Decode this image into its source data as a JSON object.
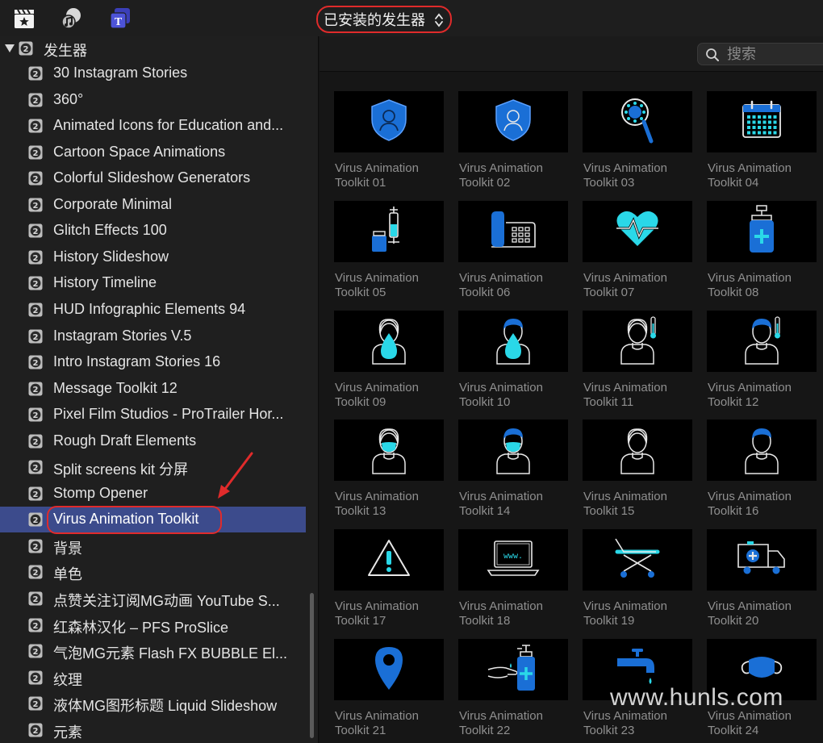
{
  "toolbar": {
    "icons": [
      "clapperboard-star-icon",
      "music-photo-icon",
      "titles-generators-icon"
    ],
    "source_select": "已安装的发生器"
  },
  "sidebar": {
    "root_label": "发生器",
    "items": [
      {
        "label": "30 Instagram Stories"
      },
      {
        "label": "360°"
      },
      {
        "label": "Animated Icons for Education and..."
      },
      {
        "label": "Cartoon Space Animations"
      },
      {
        "label": "Colorful Slideshow Generators"
      },
      {
        "label": "Corporate Minimal"
      },
      {
        "label": "Glitch Effects 100"
      },
      {
        "label": "History Slideshow"
      },
      {
        "label": "History Timeline"
      },
      {
        "label": "HUD Infographic Elements 94"
      },
      {
        "label": "Instagram Stories V.5"
      },
      {
        "label": "Intro Instagram Stories 16"
      },
      {
        "label": "Message Toolkit 12"
      },
      {
        "label": "Pixel Film Studios - ProTrailer Hor..."
      },
      {
        "label": "Rough Draft Elements"
      },
      {
        "label": "Split screens kit 分屏"
      },
      {
        "label": "Stomp Opener"
      },
      {
        "label": "Virus Animation Toolkit",
        "selected": true
      },
      {
        "label": "背景"
      },
      {
        "label": "单色"
      },
      {
        "label": "点赞关注订阅MG动画 YouTube S..."
      },
      {
        "label": "红森林汉化 – PFS ProSlice"
      },
      {
        "label": "气泡MG元素 Flash FX BUBBLE El..."
      },
      {
        "label": "纹理"
      },
      {
        "label": "液体MG图形标题 Liquid Slideshow"
      },
      {
        "label": "元素"
      }
    ]
  },
  "search": {
    "placeholder": "搜索",
    "value": ""
  },
  "browser": {
    "items": [
      {
        "line1": "Virus Animation",
        "line2": "Toolkit 01",
        "icon": "shield-person-icon"
      },
      {
        "line1": "Virus Animation",
        "line2": "Toolkit 02",
        "icon": "shield-person-outline-icon"
      },
      {
        "line1": "Virus Animation",
        "line2": "Toolkit 03",
        "icon": "magnifier-virus-icon"
      },
      {
        "line1": "Virus Animation",
        "line2": "Toolkit 04",
        "icon": "calendar-icon"
      },
      {
        "line1": "Virus Animation",
        "line2": "Toolkit 05",
        "icon": "syringe-vial-icon"
      },
      {
        "line1": "Virus Animation",
        "line2": "Toolkit 06",
        "icon": "desk-phone-icon"
      },
      {
        "line1": "Virus Animation",
        "line2": "Toolkit 07",
        "icon": "heart-pulse-icon"
      },
      {
        "line1": "Virus Animation",
        "line2": "Toolkit 08",
        "icon": "sanitizer-bottle-icon"
      },
      {
        "line1": "Virus Animation",
        "line2": "Toolkit 09",
        "icon": "person-drop-icon"
      },
      {
        "line1": "Virus Animation",
        "line2": "Toolkit 10",
        "icon": "person-drop-male-icon"
      },
      {
        "line1": "Virus Animation",
        "line2": "Toolkit 11",
        "icon": "person-thermometer-icon"
      },
      {
        "line1": "Virus Animation",
        "line2": "Toolkit 12",
        "icon": "person-thermometer-male-icon"
      },
      {
        "line1": "Virus Animation",
        "line2": "Toolkit 13",
        "icon": "person-mask-icon"
      },
      {
        "line1": "Virus Animation",
        "line2": "Toolkit 14",
        "icon": "person-mask-male-icon"
      },
      {
        "line1": "Virus Animation",
        "line2": "Toolkit 15",
        "icon": "person-icon"
      },
      {
        "line1": "Virus Animation",
        "line2": "Toolkit 16",
        "icon": "person-male-icon"
      },
      {
        "line1": "Virus Animation",
        "line2": "Toolkit 17",
        "icon": "warning-triangle-icon"
      },
      {
        "line1": "Virus Animation",
        "line2": "Toolkit 18",
        "icon": "laptop-www-icon",
        "screen_text": "www."
      },
      {
        "line1": "Virus Animation",
        "line2": "Toolkit 19",
        "icon": "stretcher-icon"
      },
      {
        "line1": "Virus Animation",
        "line2": "Toolkit 20",
        "icon": "ambulance-icon"
      },
      {
        "line1": "Virus Animation",
        "line2": "Toolkit 21",
        "icon": "location-pin-icon"
      },
      {
        "line1": "Virus Animation",
        "line2": "Toolkit 22",
        "icon": "hand-sanitizer-icon"
      },
      {
        "line1": "Virus Animation",
        "line2": "Toolkit 23",
        "icon": "faucet-icon"
      },
      {
        "line1": "Virus Animation",
        "line2": "Toolkit 24",
        "icon": "face-mask-icon"
      }
    ]
  },
  "watermark": "www.hunls.com",
  "colors": {
    "accent_blue": "#1a6fd6",
    "accent_cyan": "#2ad8e8",
    "selection": "#3c4b8c",
    "annotation_red": "#e02b2b"
  }
}
